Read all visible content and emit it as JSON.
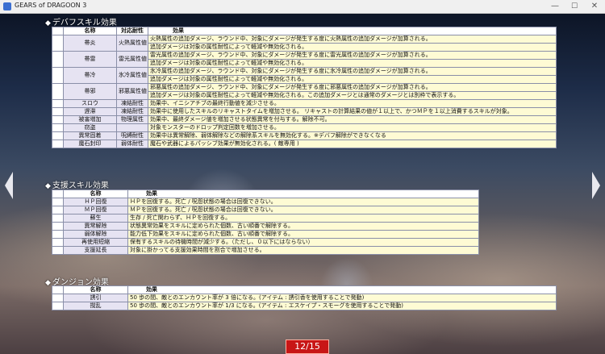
{
  "window": {
    "title": "GEARS of DRAGOON 3",
    "minimize": "—",
    "maximize": "☐",
    "close": "✕"
  },
  "debuff": {
    "title": "デバフスキル効果",
    "headers": [
      "名称",
      "対応耐性",
      "効果"
    ],
    "rows": [
      {
        "name": "帯炎",
        "attr": "火熱属性値",
        "lines": [
          "火熱属性の追加ダメージ、ラウンド中、対象にダメージが発生する度に火熱属性の追加ダメージが加算される。",
          "追加ダメージは対象の属性耐性によって軽減や無効化される。"
        ]
      },
      {
        "name": "帯雷",
        "attr": "雷光属性値",
        "lines": [
          "雷光属性の追加ダメージ、ラウンド中、対象にダメージが発生する度に雷光属性の追加ダメージが加算される。",
          "追加ダメージは対象の属性耐性によって軽減や無効化される。"
        ]
      },
      {
        "name": "帯冷",
        "attr": "氷冷属性値",
        "lines": [
          "氷冷属性の追加ダメージ、ラウンド中、対象にダメージが発生する度に氷冷属性の追加ダメージが加算される。",
          "追加ダメージは対象の属性耐性によって軽減や無効化される。"
        ]
      },
      {
        "name": "帯邪",
        "attr": "邪悪属性値",
        "lines": [
          "邪悪属性の追加ダメージ、ラウンド中、対象にダメージが発生する度に邪悪属性の追加ダメージが加算される。",
          "追加ダメージは対象の属性耐性によって軽減や無効化される。この追加ダメージとは通常のダメージとは別枠で表示する。"
        ]
      },
      {
        "name": "スロウ",
        "attr": "凍結耐性",
        "lines": [
          "効果中、イニシアチブの最終行動値を減少させる。"
        ]
      },
      {
        "name": "遅滞",
        "attr": "凍結耐性",
        "lines": [
          "効果中に使用したスキルのリキャストタイムを増加させる。 リキャストの計算結果の値が１以上で、かつＭＰを１以上消費するスキルが対象。"
        ]
      },
      {
        "name": "被害増加",
        "attr": "物理属性",
        "lines": [
          "効果中、最終ダメージ値を増加させる状態異常を付与する。解除不可。"
        ]
      },
      {
        "name": "窃盗",
        "attr": "",
        "lines": [
          "対象モンスターのドロップ判定回数を増加させる。"
        ]
      },
      {
        "name": "異常固着",
        "attr": "呪縛耐性",
        "lines": [
          "効果中は異常解除、弱体解除などの解除系スキルを無効化する。※デバフ解除ができなくなる"
        ]
      },
      {
        "name": "魔石封印",
        "attr": "弱体耐性",
        "lines": [
          "魔石や武器によるパッシブ効果が無効化される。( 敵専用 )"
        ]
      }
    ]
  },
  "support": {
    "title": "支援スキル効果",
    "headers": [
      "名称",
      "効果"
    ],
    "rows": [
      {
        "name": "ＨＰ回復",
        "effect": "ＨＰを回復する。死亡 / 呪怨状態の場合は回復できない。"
      },
      {
        "name": "ＭＰ回復",
        "effect": "ＭＰを回復する。死亡 / 呪怨状態の場合は回復できない。"
      },
      {
        "name": "蘇生",
        "effect": "生存 / 死亡関わらず、ＨＰを回復する。"
      },
      {
        "name": "異常解除",
        "effect": "状態異常効果をスキルに定められた個数、古い順番で解除する。"
      },
      {
        "name": "弱体解除",
        "effect": "能力低下効果をスキルに定められた個数、古い順番で解除する。"
      },
      {
        "name": "再使用短縮",
        "effect": "保有するスキルの待機時間が減少する。（ただし、０以下にはならない）"
      },
      {
        "name": "支援延長",
        "effect": "対象に掛かってる支援効果時間を割合で増加させる。"
      }
    ]
  },
  "dungeon": {
    "title": "ダンジョン効果",
    "headers": [
      "名称",
      "効果"
    ],
    "rows": [
      {
        "name": "誘引",
        "effect": "50 歩の間、敵とのエンカウント率が 3 倍になる。(アイテム : 誘引香を使用することで発動)"
      },
      {
        "name": "撹乱",
        "effect": "50 歩の間、敵とのエンカウント率が 1/3 になる。(アイテム : エスケイプ・スモーグを使用することで発動)"
      }
    ]
  },
  "nav": {
    "prev_icon": "arrow-left-icon",
    "next_icon": "arrow-right-icon"
  },
  "page_indicator": "12/15"
}
